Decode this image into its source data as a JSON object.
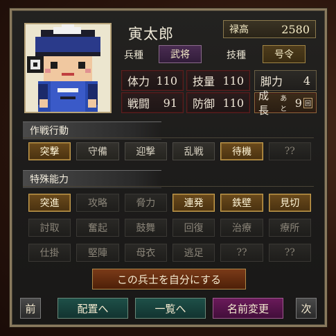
{
  "unit": {
    "name": "寅太郎",
    "rokudaka_label": "禄高",
    "rokudaka_value": "2580",
    "heishu_label": "兵種",
    "heishu_value": "武将",
    "gishu_label": "技種",
    "gishu_value": "号令"
  },
  "stats": {
    "tairyoku_label": "体力",
    "tairyoku_value": "110",
    "giryo_label": "技量",
    "giryo_value": "110",
    "kyakuryoku_label": "脚力",
    "kyakuryoku_value": "4",
    "sento_label": "戦闘",
    "sento_value": "91",
    "bogyo_label": "防御",
    "bogyo_value": "110",
    "growth_label": "成長",
    "growth_prefix": "あと",
    "growth_value": "9",
    "growth_suffix": "回"
  },
  "tactics": {
    "title": "作戦行動",
    "buttons": [
      {
        "label": "突撃",
        "state": "on"
      },
      {
        "label": "守備",
        "state": "mid"
      },
      {
        "label": "迎撃",
        "state": "mid"
      },
      {
        "label": "乱戦",
        "state": "mid"
      },
      {
        "label": "待機",
        "state": "on"
      },
      {
        "label": "??",
        "state": "off"
      }
    ]
  },
  "abilities": {
    "title": "特殊能力",
    "rows": [
      [
        {
          "label": "突進",
          "state": "on"
        },
        {
          "label": "攻略",
          "state": "off"
        },
        {
          "label": "脅力",
          "state": "off"
        },
        {
          "label": "連発",
          "state": "on"
        },
        {
          "label": "鉄壁",
          "state": "on"
        },
        {
          "label": "見切",
          "state": "on"
        }
      ],
      [
        {
          "label": "討取",
          "state": "off"
        },
        {
          "label": "奮起",
          "state": "off"
        },
        {
          "label": "鼓舞",
          "state": "off"
        },
        {
          "label": "回復",
          "state": "off"
        },
        {
          "label": "治療",
          "state": "off"
        },
        {
          "label": "療所",
          "state": "off"
        }
      ],
      [
        {
          "label": "仕掛",
          "state": "off"
        },
        {
          "label": "堅陣",
          "state": "off"
        },
        {
          "label": "母衣",
          "state": "off"
        },
        {
          "label": "逃足",
          "state": "off"
        },
        {
          "label": "??",
          "state": "off"
        },
        {
          "label": "??",
          "state": "off"
        }
      ]
    ]
  },
  "actions": {
    "own_label": "この兵士を自分にする",
    "prev_label": "前",
    "deploy_label": "配置へ",
    "list_label": "一覧へ",
    "rename_label": "名前変更",
    "next_label": "次"
  },
  "colors": {
    "active_button": "#6a4a1c",
    "inactive_button": "#1e1d1b",
    "panel_border": "#8a7a5e"
  }
}
